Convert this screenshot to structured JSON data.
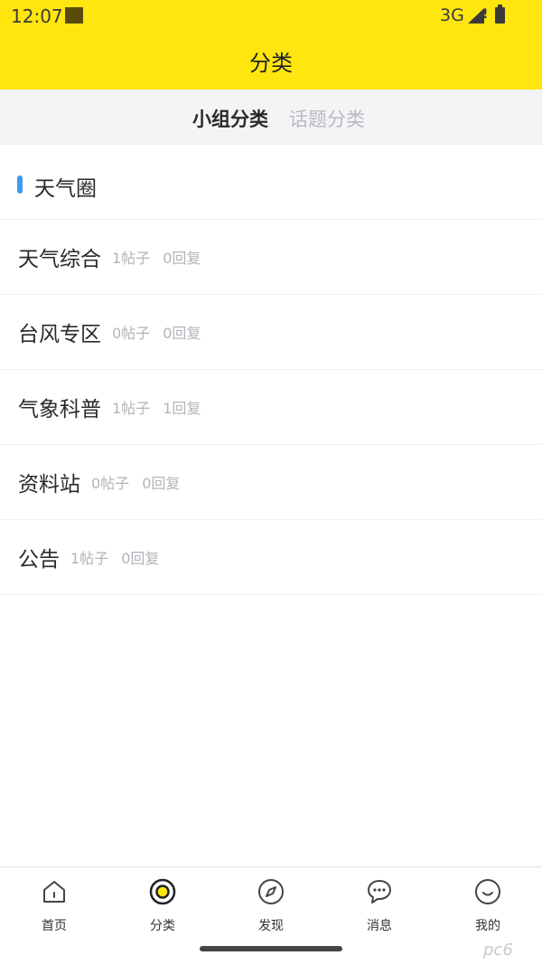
{
  "status_bar": {
    "time": "12:07",
    "network": "3G",
    "signal_icon": "signal-icon",
    "battery_icon": "battery-icon"
  },
  "header": {
    "title": "分类"
  },
  "subtabs": [
    {
      "label": "小组分类",
      "active": true
    },
    {
      "label": "话题分类",
      "active": false
    }
  ],
  "section": {
    "title": "天气圈",
    "accent_color": "#3d9bf0"
  },
  "groups": [
    {
      "name": "天气综合",
      "posts": "1帖子",
      "replies": "0回复"
    },
    {
      "name": "台风专区",
      "posts": "0帖子",
      "replies": "0回复"
    },
    {
      "name": "气象科普",
      "posts": "1帖子",
      "replies": "1回复"
    },
    {
      "name": "资料站",
      "posts": "0帖子",
      "replies": "0回复"
    },
    {
      "name": "公告",
      "posts": "1帖子",
      "replies": "0回复"
    }
  ],
  "bottom_nav": [
    {
      "label": "首页",
      "icon": "home-icon",
      "active": false
    },
    {
      "label": "分类",
      "icon": "category-icon",
      "active": true
    },
    {
      "label": "发现",
      "icon": "compass-icon",
      "active": false
    },
    {
      "label": "消息",
      "icon": "message-icon",
      "active": false
    },
    {
      "label": "我的",
      "icon": "profile-icon",
      "active": false
    }
  ],
  "watermark": "pc6",
  "colors": {
    "brand": "#ffe60f",
    "active_tab_fill": "#ffe60f",
    "muted_text": "#b3b3ba"
  }
}
